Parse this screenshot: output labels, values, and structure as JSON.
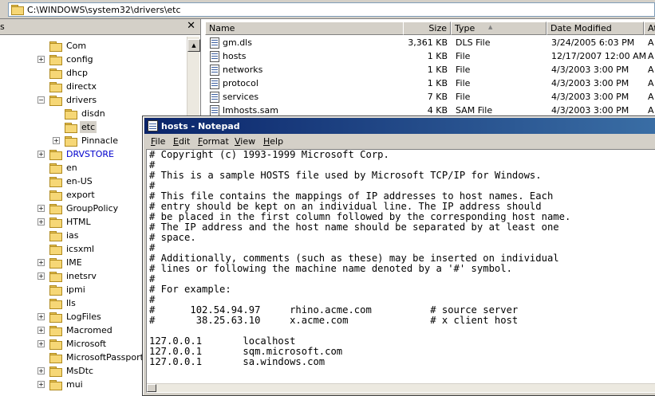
{
  "address_bar": {
    "path": "C:\\WINDOWS\\system32\\drivers\\etc"
  },
  "tree": {
    "header_title": "s",
    "close_glyph": "✕",
    "items": [
      {
        "label": "Com"
      },
      {
        "label": "config",
        "expander": "+"
      },
      {
        "label": "dhcp"
      },
      {
        "label": "directx"
      },
      {
        "label": "drivers",
        "expander": "−"
      },
      {
        "label": "disdn"
      },
      {
        "label": "etc",
        "selected": true
      },
      {
        "label": "Pinnacle",
        "expander": "+"
      },
      {
        "label": "DRVSTORE",
        "expander": "+",
        "color": "#0000cc"
      },
      {
        "label": "en"
      },
      {
        "label": "en-US"
      },
      {
        "label": "export"
      },
      {
        "label": "GroupPolicy",
        "expander": "+"
      },
      {
        "label": "HTML",
        "expander": "+"
      },
      {
        "label": "ias"
      },
      {
        "label": "icsxml"
      },
      {
        "label": "IME",
        "expander": "+"
      },
      {
        "label": "inetsrv",
        "expander": "+"
      },
      {
        "label": "ipmi"
      },
      {
        "label": "lls"
      },
      {
        "label": "LogFiles",
        "expander": "+"
      },
      {
        "label": "Macromed",
        "expander": "+"
      },
      {
        "label": "Microsoft",
        "expander": "+"
      },
      {
        "label": "MicrosoftPassport"
      },
      {
        "label": "MsDtc",
        "expander": "+"
      },
      {
        "label": "mui",
        "expander": "+"
      }
    ]
  },
  "file_list": {
    "columns": {
      "name": "Name",
      "size": "Size",
      "type": "Type",
      "sort_glyph": "▲",
      "modified": "Date Modified",
      "attributes": "At"
    },
    "rows": [
      {
        "name": "gm.dls",
        "size": "3,361 KB",
        "type": "DLS File",
        "modified": "3/24/2005 6:03 PM",
        "attr": "A"
      },
      {
        "name": "hosts",
        "size": "1 KB",
        "type": "File",
        "modified": "12/17/2007 12:00 AM",
        "attr": "A"
      },
      {
        "name": "networks",
        "size": "1 KB",
        "type": "File",
        "modified": "4/3/2003 3:00 PM",
        "attr": "A"
      },
      {
        "name": "protocol",
        "size": "1 KB",
        "type": "File",
        "modified": "4/3/2003 3:00 PM",
        "attr": "A"
      },
      {
        "name": "services",
        "size": "7 KB",
        "type": "File",
        "modified": "4/3/2003 3:00 PM",
        "attr": "A"
      },
      {
        "name": "lmhosts.sam",
        "size": "4 KB",
        "type": "SAM File",
        "modified": "4/3/2003 3:00 PM",
        "attr": "A"
      }
    ]
  },
  "notepad": {
    "title": "hosts - Notepad",
    "menu": [
      {
        "key": "F",
        "rest": "ile"
      },
      {
        "key": "E",
        "rest": "dit"
      },
      {
        "key": "",
        "rest": "Format",
        "under_first": "F",
        "text": "ormat"
      },
      {
        "key": "V",
        "rest": "iew"
      },
      {
        "key": "H",
        "rest": "elp"
      }
    ],
    "content": "# Copyright (c) 1993-1999 Microsoft Corp.\n#\n# This is a sample HOSTS file used by Microsoft TCP/IP for Windows.\n#\n# This file contains the mappings of IP addresses to host names. Each\n# entry should be kept on an individual line. The IP address should\n# be placed in the first column followed by the corresponding host name.\n# The IP address and the host name should be separated by at least one\n# space.\n#\n# Additionally, comments (such as these) may be inserted on individual\n# lines or following the machine name denoted by a '#' symbol.\n#\n# For example:\n#\n#      102.54.94.97     rhino.acme.com          # source server\n#       38.25.63.10     x.acme.com              # x client host\n\n127.0.0.1       localhost\n127.0.0.1       sqm.microsoft.com\n127.0.0.1       sa.windows.com"
  }
}
